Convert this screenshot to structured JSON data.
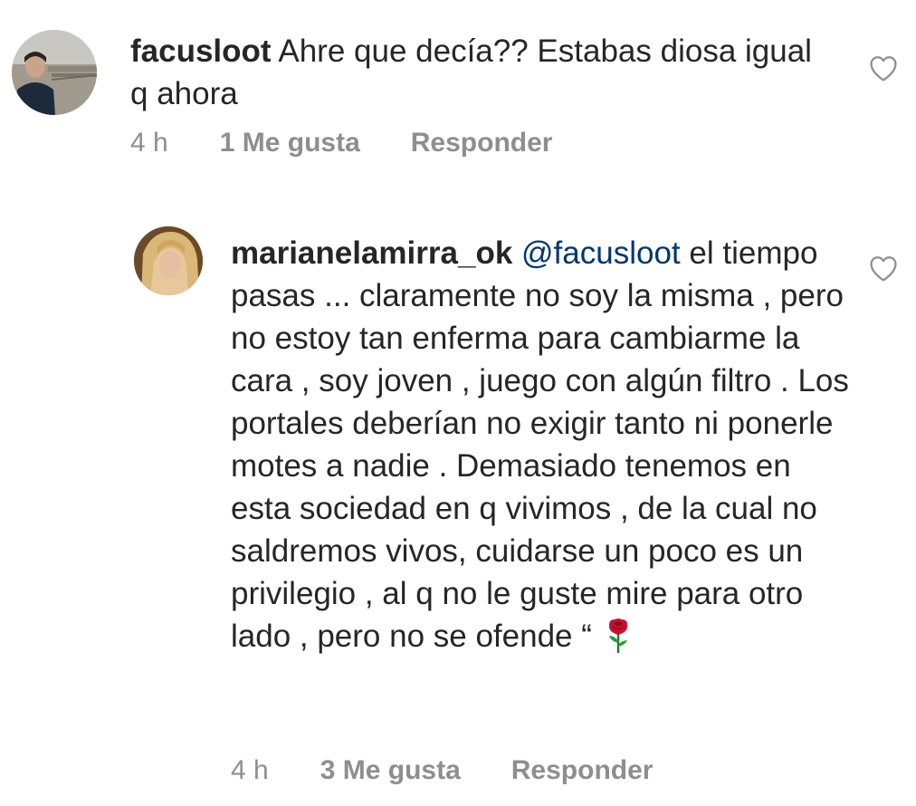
{
  "comments": [
    {
      "username": "facusloot",
      "text": "Ahre que decía?? Estabas diosa igual q ahora",
      "time": "4 h",
      "likes": "1 Me gusta",
      "reply_label": "Responder"
    },
    {
      "username": "marianelamirra_ok",
      "mention": "@facusloot",
      "text": "el tiempo pasas ... claramente no soy la misma , pero no estoy tan enferma para cambiarme la cara , soy joven , juego con algún filtro . Los portales deberían no exigir tanto ni ponerle motes a nadie . Demasiado tenemos en esta sociedad en q vivimos , de la cual no saldremos vivos, cuidarse un poco es un privilegio , al q no le guste mire para otro lado , pero no se ofende “",
      "emoji": "rose-emoji",
      "time": "4 h",
      "likes": "3 Me gusta",
      "reply_label": "Responder"
    }
  ],
  "colors": {
    "text": "#262626",
    "secondary": "#8e8e8e",
    "mention": "#00376b",
    "rose": "#c8102e"
  },
  "icons": {
    "like": "heart-outline-icon"
  }
}
